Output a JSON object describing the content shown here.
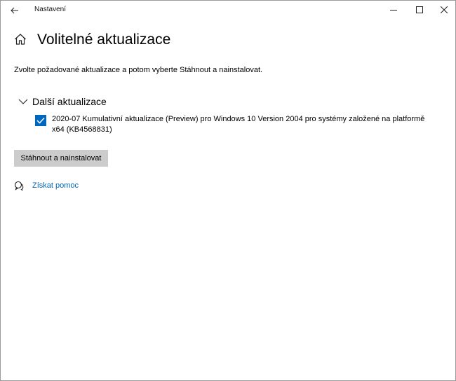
{
  "window": {
    "title": "Nastavení"
  },
  "icons": {
    "back": "back-arrow-icon",
    "minimize": "minimize-icon",
    "maximize": "maximize-icon",
    "close": "close-icon",
    "home": "home-icon",
    "chevron": "chevron-down-icon",
    "checkmark": "checkmark-icon",
    "help": "chat-help-icon"
  },
  "page": {
    "title": "Volitelné aktualizace",
    "description": "Zvolte požadované aktualizace a potom vyberte Stáhnout a nainstalovat."
  },
  "section": {
    "label": "Další aktualizace",
    "items": [
      {
        "checked": true,
        "label": "2020-07 Kumulativní aktualizace (Preview) pro Windows 10 Version 2004 pro systémy založené na platformě x64 (KB4568831)"
      }
    ]
  },
  "actions": {
    "download_label": "Stáhnout a nainstalovat"
  },
  "help": {
    "label": "Získat pomoc"
  },
  "colors": {
    "accent": "#0067c0",
    "link": "#0063b1",
    "button_bg": "#cccccc"
  }
}
